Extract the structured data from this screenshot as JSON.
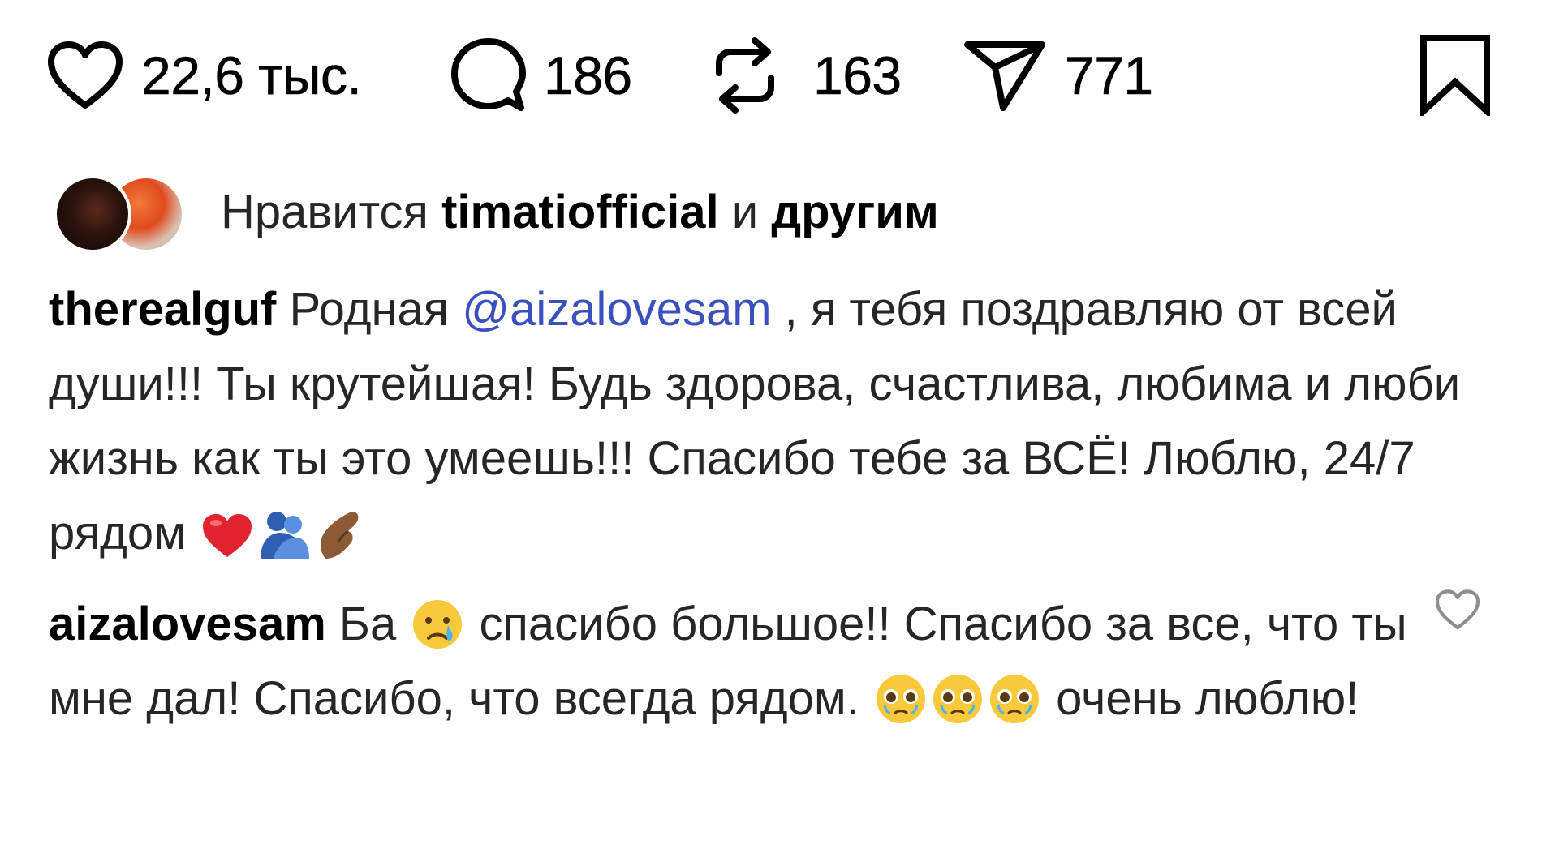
{
  "actions": {
    "likes_count": "22,6 тыс.",
    "comments_count": "186",
    "reposts_count": "163",
    "shares_count": "771"
  },
  "liked_by": {
    "prefix": "Нравится",
    "user": "timatiofficial",
    "conjunction": "и",
    "others": "другим"
  },
  "comments": [
    {
      "username": "therealguf",
      "text_before": " Родная ",
      "mention": "@aizalovesam",
      "text_after": " , я тебя поздравляю от всей души!!! Ты крутейшая! Будь здорова, счастлива, любима и люби жизнь как ты это умеешь!!! Спасибо тебе за ВСЁ! Люблю, 24/7 рядом ",
      "emojis": [
        "red-heart",
        "people-hugging",
        "pinching-hand"
      ]
    },
    {
      "username": "aizalovesam",
      "part1": " Ба ",
      "part2": " спасибо большое!! Спасибо за все, что ты мне дал! Спасибо, что всегда рядом. ",
      "part3": " очень люблю!",
      "emojis": [
        "crying-face",
        "pleading-face",
        "pleading-face",
        "pleading-face"
      ]
    }
  ],
  "colors": {
    "text": "#262626",
    "username": "#000000",
    "mention": "#3b4fbf",
    "comment_like_icon": "#8e8e8e"
  }
}
